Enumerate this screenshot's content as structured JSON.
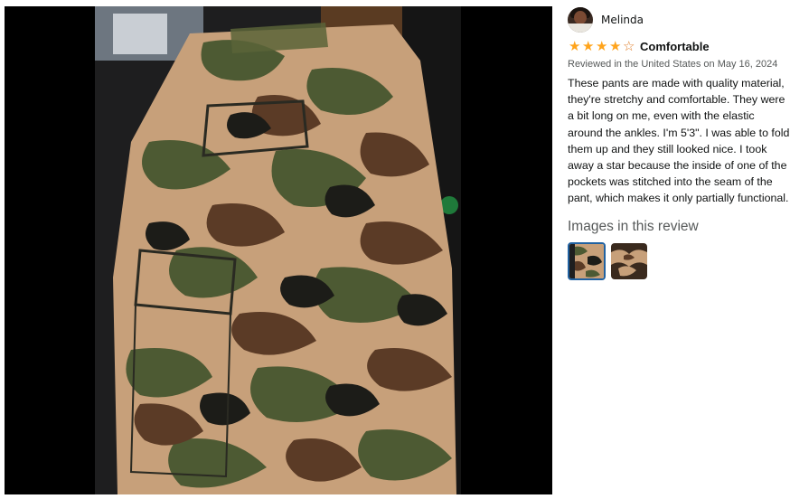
{
  "viewer": {
    "main_image": "camouflage cargo pants photo"
  },
  "review": {
    "reviewer_name": "Melinda",
    "rating": 4,
    "rating_max": 5,
    "headline": "Comfortable",
    "meta": "Reviewed in the United States on May 16, 2024",
    "body": "These pants are made with quality material, they're stretchy and comfortable. They were a bit long on me, even with the elastic around the ankles. I'm 5'3\". I was able to fold them up and they still looked nice. I took away a star because the inside of one of the pockets was stitched into the seam of the pant, which makes it only partially functional.",
    "images_heading": "Images in this review",
    "thumbnails": [
      {
        "selected": true
      },
      {
        "selected": false
      }
    ]
  },
  "colors": {
    "star": "#ffa41c",
    "star_outline": "#de7921",
    "selected_border": "#2162a1",
    "meta_text": "#565959"
  }
}
